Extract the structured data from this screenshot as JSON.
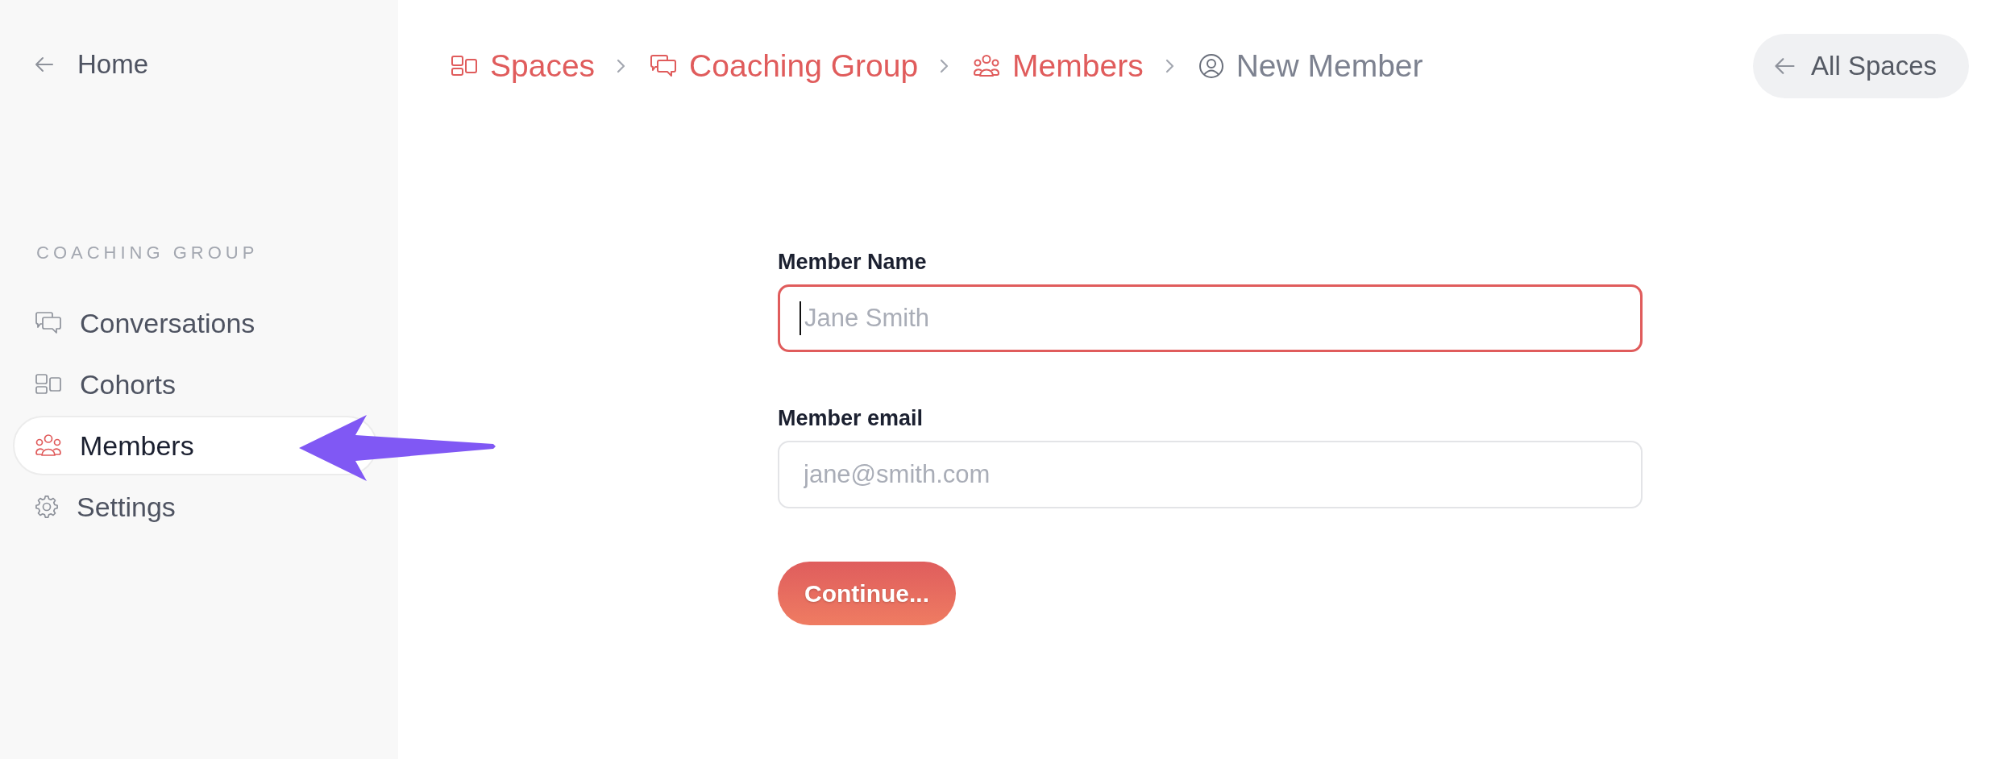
{
  "sidebar": {
    "back_link": {
      "label": "Home"
    },
    "section_title": "COACHING GROUP",
    "items": [
      {
        "label": "Conversations",
        "selected": false
      },
      {
        "label": "Cohorts",
        "selected": false
      },
      {
        "label": "Members",
        "selected": true
      },
      {
        "label": "Settings",
        "selected": false
      }
    ]
  },
  "breadcrumb": [
    {
      "label": "Spaces",
      "current": false
    },
    {
      "label": "Coaching Group",
      "current": false
    },
    {
      "label": "Members",
      "current": false
    },
    {
      "label": "New Member",
      "current": true
    }
  ],
  "header_button": {
    "label": "All Spaces"
  },
  "form": {
    "fields": [
      {
        "label": "Member Name",
        "placeholder": "Jane Smith",
        "focused": true
      },
      {
        "label": "Member email",
        "placeholder": "jane@smith.com",
        "focused": false
      }
    ],
    "submit": {
      "label": "Continue..."
    }
  }
}
